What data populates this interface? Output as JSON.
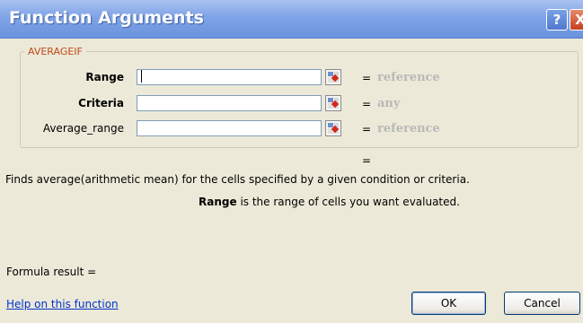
{
  "window": {
    "title": "Function Arguments",
    "help_glyph": "?",
    "close_glyph": "X"
  },
  "function_group": {
    "name": "AVERAGEIF",
    "arguments": [
      {
        "label": "Range",
        "value": "",
        "equals": "=",
        "type": "reference",
        "bold": true
      },
      {
        "label": "Criteria",
        "value": "",
        "equals": "=",
        "type": "any",
        "bold": true
      },
      {
        "label": "Average_range",
        "value": "",
        "equals": "=",
        "type": "reference",
        "bold": false
      }
    ],
    "result_equals": "="
  },
  "description": "Finds average(arithmetic mean) for the cells specified by a given condition or criteria.",
  "argument_help": {
    "name": "Range",
    "text": "is the range of cells you want evaluated."
  },
  "formula_result": "Formula result =",
  "help_link": "Help on this function",
  "buttons": {
    "ok": "OK",
    "cancel": "Cancel"
  },
  "colors": {
    "title_bar": "#7fa4e6",
    "group_label": "#c04a1a",
    "type_hint": "#b8b8b8",
    "link": "#0033cc"
  }
}
